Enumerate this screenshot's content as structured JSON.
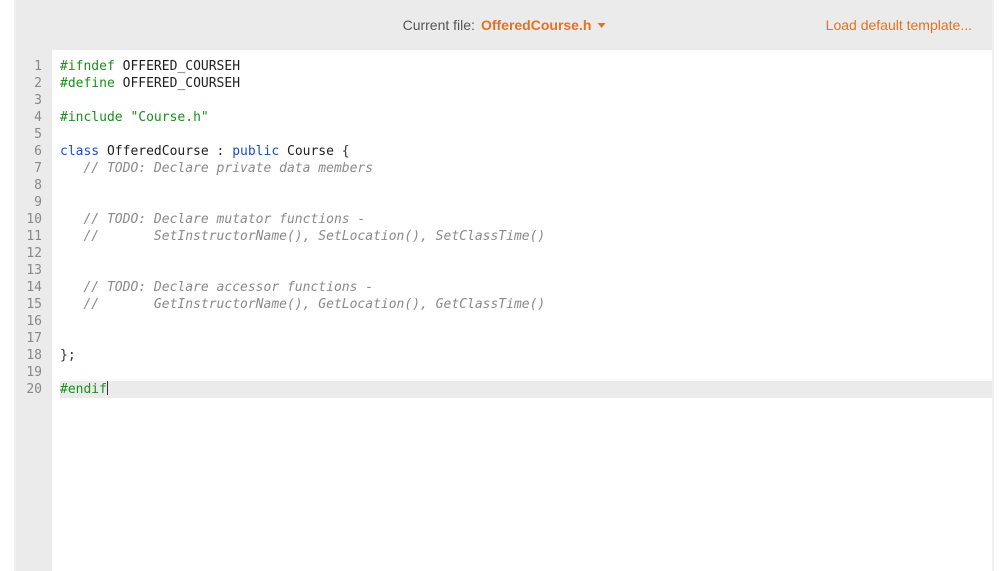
{
  "header": {
    "label": "Current file:",
    "filename": "OfferedCourse.h",
    "load_template": "Load default template..."
  },
  "editor": {
    "cursor_line": 20,
    "lines": [
      {
        "n": 1,
        "t": [
          [
            "pre",
            "#ifndef"
          ],
          [
            "sp",
            " "
          ],
          [
            "ident",
            "OFFERED_COURSEH"
          ]
        ]
      },
      {
        "n": 2,
        "t": [
          [
            "pre",
            "#define"
          ],
          [
            "sp",
            " "
          ],
          [
            "ident",
            "OFFERED_COURSEH"
          ]
        ]
      },
      {
        "n": 3,
        "t": []
      },
      {
        "n": 4,
        "t": [
          [
            "pre",
            "#include"
          ],
          [
            "sp",
            " "
          ],
          [
            "str",
            "\"Course.h\""
          ]
        ]
      },
      {
        "n": 5,
        "t": []
      },
      {
        "n": 6,
        "t": [
          [
            "kw",
            "class"
          ],
          [
            "sp",
            " "
          ],
          [
            "ident",
            "OfferedCourse"
          ],
          [
            "sp",
            " "
          ],
          [
            "pn",
            ":"
          ],
          [
            "sp",
            " "
          ],
          [
            "kw",
            "public"
          ],
          [
            "sp",
            " "
          ],
          [
            "ident",
            "Course"
          ],
          [
            "sp",
            " "
          ],
          [
            "pn",
            "{"
          ]
        ]
      },
      {
        "n": 7,
        "t": [
          [
            "sp",
            "   "
          ],
          [
            "cmt",
            "// TODO: Declare private data members"
          ]
        ]
      },
      {
        "n": 8,
        "t": []
      },
      {
        "n": 9,
        "t": []
      },
      {
        "n": 10,
        "t": [
          [
            "sp",
            "   "
          ],
          [
            "cmt",
            "// TODO: Declare mutator functions -"
          ]
        ]
      },
      {
        "n": 11,
        "t": [
          [
            "sp",
            "   "
          ],
          [
            "cmt",
            "//       SetInstructorName(), SetLocation(), SetClassTime()"
          ]
        ]
      },
      {
        "n": 12,
        "t": []
      },
      {
        "n": 13,
        "t": []
      },
      {
        "n": 14,
        "t": [
          [
            "sp",
            "   "
          ],
          [
            "cmt",
            "// TODO: Declare accessor functions -"
          ]
        ]
      },
      {
        "n": 15,
        "t": [
          [
            "sp",
            "   "
          ],
          [
            "cmt",
            "//       GetInstructorName(), GetLocation(), GetClassTime()"
          ]
        ]
      },
      {
        "n": 16,
        "t": []
      },
      {
        "n": 17,
        "t": []
      },
      {
        "n": 18,
        "t": [
          [
            "pn",
            "};"
          ]
        ]
      },
      {
        "n": 19,
        "t": []
      },
      {
        "n": 20,
        "t": [
          [
            "pre",
            "#endif"
          ]
        ]
      }
    ]
  }
}
